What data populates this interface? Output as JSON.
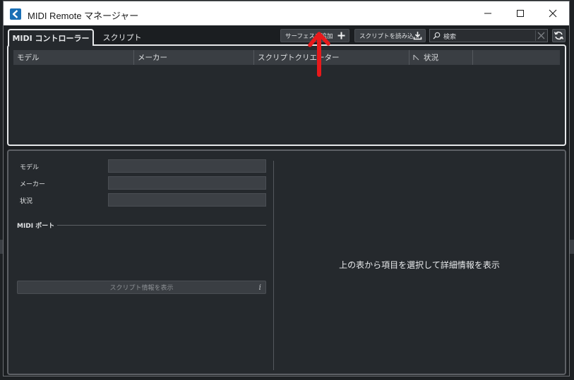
{
  "window": {
    "title": "MIDI Remote マネージャー"
  },
  "tabs": [
    {
      "label": "MIDI コントローラー",
      "active": true
    },
    {
      "label": "スクリプト",
      "active": false
    }
  ],
  "toolbar": {
    "add_surface_label": "サーフェスを追加",
    "import_script_label": "スクリプトを読み込...",
    "search_placeholder": "検索"
  },
  "table": {
    "columns": [
      "モデル",
      "メーカー",
      "スクリプトクリエーター",
      "状況",
      ""
    ]
  },
  "details": {
    "fields": [
      {
        "label": "モデル",
        "value": ""
      },
      {
        "label": "メーカー",
        "value": ""
      },
      {
        "label": "状況",
        "value": ""
      }
    ],
    "midi_port_label": "MIDI ポート",
    "script_info_button": "スクリプト情報を表示",
    "placeholder": "上の表から項目を選択して詳細情報を表示"
  },
  "colors": {
    "accent": "#1a6fb5",
    "annotation_arrow": "#e8191b",
    "panel_bg": "#25292d"
  }
}
